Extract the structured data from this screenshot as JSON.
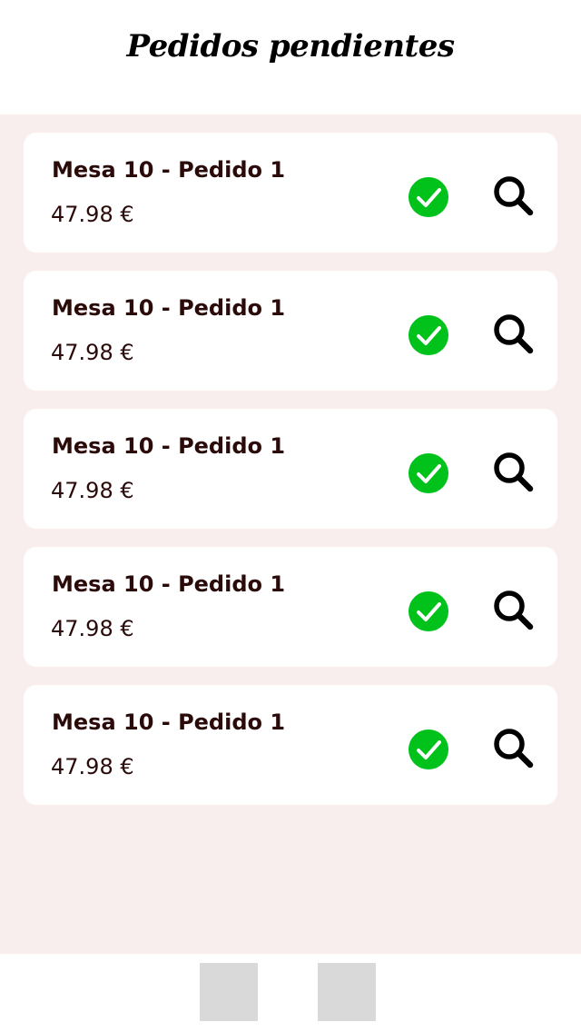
{
  "header": {
    "title": "Pedidos pendientes"
  },
  "colors": {
    "background": "#f7eeed",
    "card": "#ffffff",
    "text": "#2b0a0a",
    "confirm": "#00c21a",
    "placeholder": "#d9d9d9"
  },
  "orders": [
    {
      "title": "Mesa 10 - Pedido 1",
      "price": "47.98 €",
      "confirm_icon": "check-circle-icon",
      "view_icon": "search-icon"
    },
    {
      "title": "Mesa 10 - Pedido 1",
      "price": "47.98 €",
      "confirm_icon": "check-circle-icon",
      "view_icon": "search-icon"
    },
    {
      "title": "Mesa 10 - Pedido 1",
      "price": "47.98 €",
      "confirm_icon": "check-circle-icon",
      "view_icon": "search-icon"
    },
    {
      "title": "Mesa 10 - Pedido 1",
      "price": "47.98 €",
      "confirm_icon": "check-circle-icon",
      "view_icon": "search-icon"
    },
    {
      "title": "Mesa 10 - Pedido 1",
      "price": "47.98 €",
      "confirm_icon": "check-circle-icon",
      "view_icon": "search-icon"
    }
  ],
  "bottom_nav": {
    "items": [
      {
        "icon": "placeholder-icon"
      },
      {
        "icon": "placeholder-icon"
      }
    ]
  }
}
